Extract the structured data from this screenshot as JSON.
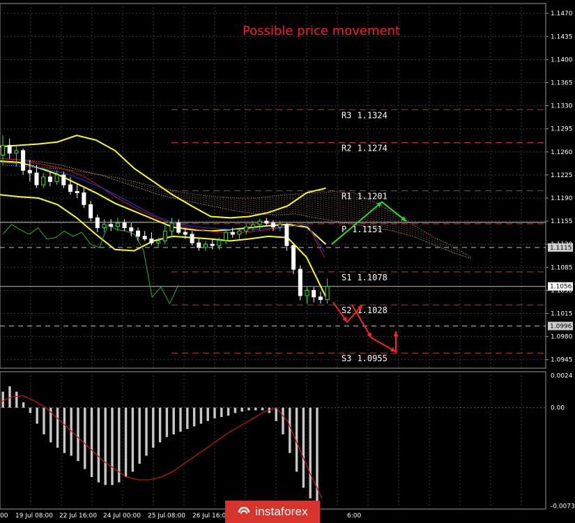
{
  "title": "Possible price movement",
  "colors": {
    "background": "#000000",
    "title": "#ff1a1a",
    "bull_candle": "#2ee82e",
    "bear_candle": "#ffffff",
    "bollinger": "#ffff00",
    "tenkan": "#d01010",
    "kijun": "#1a3cff",
    "chikou": "#22b522",
    "kumo": "#cc9966",
    "level_line": "#cc3322",
    "histogram": "#c8c8c8",
    "signal": "#d01010",
    "forecast_up": "#22dd22",
    "forecast_down": "#ff2020",
    "logo_bg": "#d9342b"
  },
  "logo": {
    "text": "instaforex",
    "icon": "instaforex-logo-mark"
  },
  "chart_data": [
    {
      "type": "line",
      "name": "price",
      "ylim": [
        1.0932,
        1.1485
      ],
      "y_ticks": [
        "1.1470",
        "1.1435",
        "1.1400",
        "1.1365",
        "1.1330",
        "1.1295",
        "1.1260",
        "1.1225",
        "1.1190",
        "1.1155",
        "1.1120",
        "1.1085",
        "1.1050",
        "1.1015",
        "1.0980",
        "1.0945"
      ],
      "x_ticks": [
        "00",
        "19 Jul 08:00",
        "22 Jul 16:00",
        "24 Jul 00:00",
        "25 Jul 08:00",
        "26 Jul 16:00",
        "6:00"
      ],
      "price_tags": [
        {
          "label": "1.1115",
          "value": 1.1115
        },
        {
          "label": "1.1056",
          "value": 1.1056
        },
        {
          "label": "1.0996",
          "value": 1.0996
        }
      ],
      "levels": [
        {
          "name": "R3",
          "value_text": "1.1324",
          "value": 1.1324
        },
        {
          "name": "R2",
          "value_text": "1.1274",
          "value": 1.1274
        },
        {
          "name": "R1",
          "value_text": "1.1201",
          "value": 1.1201
        },
        {
          "name": "P",
          "value_text": "1.1151",
          "value": 1.1151
        },
        {
          "name": "S1",
          "value_text": "1.1078",
          "value": 1.1078
        },
        {
          "name": "S2",
          "value_text": "1.1028",
          "value": 1.1028
        },
        {
          "name": "S3",
          "value_text": "1.0955",
          "value": 1.0955
        }
      ],
      "candles": [
        [
          1.1255,
          1.1285,
          1.124,
          1.127
        ],
        [
          1.127,
          1.128,
          1.125,
          1.1258
        ],
        [
          1.1258,
          1.1268,
          1.1238,
          1.1262
        ],
        [
          1.1262,
          1.1265,
          1.1225,
          1.1232
        ],
        [
          1.1232,
          1.1248,
          1.1215,
          1.1228
        ],
        [
          1.1228,
          1.124,
          1.1205,
          1.121
        ],
        [
          1.121,
          1.1228,
          1.1205,
          1.1222
        ],
        [
          1.1222,
          1.123,
          1.1208,
          1.1215
        ],
        [
          1.1215,
          1.1232,
          1.121,
          1.1225
        ],
        [
          1.1225,
          1.123,
          1.1205,
          1.121
        ],
        [
          1.121,
          1.1222,
          1.1195,
          1.12
        ],
        [
          1.12,
          1.1212,
          1.119,
          1.1198
        ],
        [
          1.1198,
          1.1205,
          1.1175,
          1.118
        ],
        [
          1.118,
          1.1186,
          1.1155,
          1.116
        ],
        [
          1.116,
          1.1165,
          1.1138,
          1.1145
        ],
        [
          1.1145,
          1.1158,
          1.1138,
          1.115
        ],
        [
          1.115,
          1.1158,
          1.114,
          1.1147
        ],
        [
          1.1147,
          1.116,
          1.114,
          1.1152
        ],
        [
          1.1152,
          1.1158,
          1.114,
          1.1145
        ],
        [
          1.1145,
          1.1152,
          1.1132,
          1.114
        ],
        [
          1.114,
          1.1145,
          1.1125,
          1.1132
        ],
        [
          1.1132,
          1.114,
          1.1125,
          1.1128
        ],
        [
          1.1128,
          1.1138,
          1.1118,
          1.1122
        ],
        [
          1.1122,
          1.113,
          1.1115,
          1.1125
        ],
        [
          1.1125,
          1.1148,
          1.112,
          1.114
        ],
        [
          1.114,
          1.116,
          1.113,
          1.1152
        ],
        [
          1.1152,
          1.1158,
          1.1135,
          1.1138
        ],
        [
          1.1138,
          1.1145,
          1.1128,
          1.1135
        ],
        [
          1.1135,
          1.114,
          1.1118,
          1.1122
        ],
        [
          1.1122,
          1.1128,
          1.111,
          1.1115
        ],
        [
          1.1115,
          1.1125,
          1.111,
          1.112
        ],
        [
          1.112,
          1.1128,
          1.1112,
          1.1118
        ],
        [
          1.1118,
          1.113,
          1.1112,
          1.1126
        ],
        [
          1.1126,
          1.114,
          1.112,
          1.1138
        ],
        [
          1.1138,
          1.1145,
          1.113,
          1.1135
        ],
        [
          1.1135,
          1.1142,
          1.1128,
          1.114
        ],
        [
          1.114,
          1.115,
          1.1135,
          1.1146
        ],
        [
          1.1146,
          1.1155,
          1.114,
          1.115
        ],
        [
          1.115,
          1.1158,
          1.1142,
          1.1155
        ],
        [
          1.1155,
          1.116,
          1.1148,
          1.1152
        ],
        [
          1.1152,
          1.1156,
          1.114,
          1.1146
        ],
        [
          1.1146,
          1.1155,
          1.114,
          1.115
        ],
        [
          1.115,
          1.1152,
          1.111,
          1.1118
        ],
        [
          1.1118,
          1.1122,
          1.1075,
          1.1082
        ],
        [
          1.1082,
          1.1088,
          1.1035,
          1.1042
        ],
        [
          1.1042,
          1.1055,
          1.103,
          1.105
        ],
        [
          1.105,
          1.1055,
          1.1032,
          1.104
        ],
        [
          1.104,
          1.1048,
          1.103,
          1.1036
        ],
        [
          1.1036,
          1.1068,
          1.103,
          1.1056
        ]
      ],
      "bollinger_upper": [
        1.1268,
        1.127,
        1.1272,
        1.1275,
        1.1285,
        1.1278,
        1.1262,
        1.1235,
        1.1215,
        1.1195,
        1.1178,
        1.1162,
        1.116,
        1.1162,
        1.1168,
        1.1178,
        1.1198,
        1.1205
      ],
      "bollinger_middle": [
        1.1246,
        1.1244,
        1.1236,
        1.1226,
        1.1212,
        1.1198,
        1.1182,
        1.117,
        1.1158,
        1.1146,
        1.1142,
        1.114,
        1.1142,
        1.1145,
        1.1148,
        1.115,
        1.1146,
        1.112
      ],
      "bollinger_lower": [
        1.1195,
        1.1192,
        1.119,
        1.118,
        1.116,
        1.1135,
        1.1112,
        1.111,
        1.1125,
        1.1132,
        1.113,
        1.1128,
        1.1125,
        1.1128,
        1.1132,
        1.113,
        1.11,
        1.104
      ],
      "tenkan": [
        1.125,
        1.1248,
        1.1244,
        1.1238,
        1.1232,
        1.1222,
        1.1205,
        1.1188,
        1.1174,
        1.1162,
        1.1152,
        1.1145,
        1.114,
        1.1138,
        1.1137,
        1.114,
        1.1143,
        1.1147,
        1.115,
        1.11
      ],
      "kijun": [
        1.1244,
        1.1242,
        1.1238,
        1.1232,
        1.1226,
        1.1216,
        1.1205,
        1.1192,
        1.1178,
        1.1164,
        1.1154,
        1.1148,
        1.1145,
        1.1143,
        1.1142,
        1.1143,
        1.1144,
        1.1147,
        1.115,
        1.1108
      ],
      "chikou": [
        1.1135,
        1.115,
        1.1142,
        1.1135,
        1.1145,
        1.1128,
        1.113,
        1.114,
        1.1132,
        1.1138,
        1.112,
        1.1115,
        1.115,
        1.1142,
        1.114,
        1.1135,
        1.1112,
        1.104,
        1.1055,
        1.103,
        1.1058
      ],
      "kumo_a": [
        1.125,
        1.1248,
        1.1245,
        1.124,
        1.1232,
        1.1225,
        1.1215,
        1.1205,
        1.1195,
        1.1188,
        1.1182,
        1.1176,
        1.117,
        1.1166,
        1.1164,
        1.1166,
        1.116,
        1.1155,
        1.115,
        1.1145,
        1.114,
        1.1132,
        1.112,
        1.1108,
        1.1098
      ],
      "kumo_b": [
        1.124,
        1.1238,
        1.1236,
        1.1234,
        1.123,
        1.1225,
        1.122,
        1.1213,
        1.1206,
        1.12,
        1.1195,
        1.1192,
        1.119,
        1.119,
        1.1194,
        1.1196,
        1.1198,
        1.12,
        1.1198,
        1.1185,
        1.1168,
        1.115,
        1.1132,
        1.1118,
        1.11
      ],
      "forecast_up": [
        1.112,
        1.1184,
        1.1155
      ],
      "forecast_down": [
        1.1032,
        1.1002,
        1.1028,
        1.0978,
        1.0957,
        1.0988
      ]
    },
    {
      "type": "bar",
      "name": "MACD",
      "ylim": [
        -0.0076,
        0.0027
      ],
      "y_ticks": [
        "0.0024",
        "0.00",
        "-0.00737"
      ],
      "histogram": [
        0.0012,
        0.0016,
        0.0012,
        0.0004,
        -0.0004,
        -0.0012,
        -0.002,
        -0.0026,
        -0.003,
        -0.0034,
        -0.0036,
        -0.004,
        -0.0046,
        -0.0052,
        -0.0056,
        -0.0058,
        -0.0058,
        -0.0056,
        -0.0052,
        -0.0048,
        -0.0042,
        -0.0036,
        -0.003,
        -0.0026,
        -0.0022,
        -0.002,
        -0.0018,
        -0.0016,
        -0.0014,
        -0.0012,
        -0.001,
        -0.0008,
        -0.0007,
        -0.0006,
        -0.0004,
        -0.0003,
        -0.0002,
        -0.0002,
        -0.0002,
        -0.0004,
        -0.001,
        -0.002,
        -0.0034,
        -0.0048,
        -0.006,
        -0.0068,
        -0.0072
      ],
      "signal": [
        0.0004,
        0.0008,
        0.0009,
        0.0005,
        0.0,
        -0.0008,
        -0.0016,
        -0.0024,
        -0.0032,
        -0.004,
        -0.0046,
        -0.0052,
        -0.0054,
        -0.0054,
        -0.0052,
        -0.0048,
        -0.0042,
        -0.0036,
        -0.003,
        -0.0024,
        -0.0018,
        -0.0013,
        -0.0008,
        -0.0003,
        0.0,
        -0.001,
        -0.003,
        -0.005,
        -0.0068
      ]
    }
  ]
}
